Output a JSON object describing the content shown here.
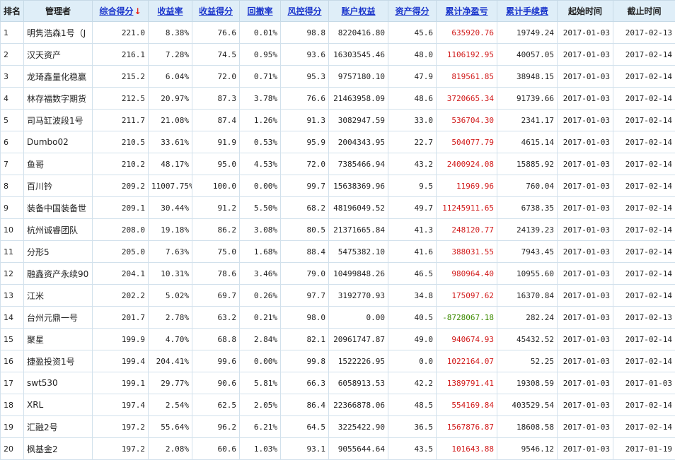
{
  "headers": [
    {
      "key": "rank",
      "label": "排名",
      "sortable": false
    },
    {
      "key": "manager",
      "label": "管理者",
      "sortable": false
    },
    {
      "key": "score",
      "label": "综合得分",
      "sortable": true,
      "active": true,
      "arrow": "↓"
    },
    {
      "key": "return_rate",
      "label": "收益率",
      "sortable": true
    },
    {
      "key": "return_score",
      "label": "收益得分",
      "sortable": true
    },
    {
      "key": "drawdown",
      "label": "回撤率",
      "sortable": true
    },
    {
      "key": "risk_score",
      "label": "风控得分",
      "sortable": true
    },
    {
      "key": "equity",
      "label": "账户权益",
      "sortable": true
    },
    {
      "key": "asset_score",
      "label": "资产得分",
      "sortable": true
    },
    {
      "key": "net_pnl",
      "label": "累计净盈亏",
      "sortable": true
    },
    {
      "key": "fees",
      "label": "累计手续费",
      "sortable": true
    },
    {
      "key": "start",
      "label": "起始时间",
      "sortable": false
    },
    {
      "key": "end",
      "label": "截止时间",
      "sortable": false
    }
  ],
  "rows": [
    {
      "rank": "1",
      "manager": "明隽浩森1号（J",
      "score": "221.0",
      "return_rate": "8.38%",
      "return_score": "76.6",
      "drawdown": "0.01%",
      "risk_score": "98.8",
      "equity": "8220416.80",
      "asset_score": "45.6",
      "net_pnl": "635920.76",
      "net_pnl_sign": "pos",
      "fees": "19749.24",
      "start": "2017-01-03",
      "end": "2017-02-13"
    },
    {
      "rank": "2",
      "manager": "汉天资产",
      "score": "216.1",
      "return_rate": "7.28%",
      "return_score": "74.5",
      "drawdown": "0.95%",
      "risk_score": "93.6",
      "equity": "16303545.46",
      "asset_score": "48.0",
      "net_pnl": "1106192.95",
      "net_pnl_sign": "pos",
      "fees": "40057.05",
      "start": "2017-01-03",
      "end": "2017-02-14"
    },
    {
      "rank": "3",
      "manager": "龙琦鑫量化稳赢",
      "score": "215.2",
      "return_rate": "6.04%",
      "return_score": "72.0",
      "drawdown": "0.71%",
      "risk_score": "95.3",
      "equity": "9757180.10",
      "asset_score": "47.9",
      "net_pnl": "819561.85",
      "net_pnl_sign": "pos",
      "fees": "38948.15",
      "start": "2017-01-03",
      "end": "2017-02-14"
    },
    {
      "rank": "4",
      "manager": "林存福数字期货",
      "score": "212.5",
      "return_rate": "20.97%",
      "return_score": "87.3",
      "drawdown": "3.78%",
      "risk_score": "76.6",
      "equity": "21463958.09",
      "asset_score": "48.6",
      "net_pnl": "3720665.34",
      "net_pnl_sign": "pos",
      "fees": "91739.66",
      "start": "2017-01-03",
      "end": "2017-02-14"
    },
    {
      "rank": "5",
      "manager": "司马缸波段1号",
      "score": "211.7",
      "return_rate": "21.08%",
      "return_score": "87.4",
      "drawdown": "1.26%",
      "risk_score": "91.3",
      "equity": "3082947.59",
      "asset_score": "33.0",
      "net_pnl": "536704.30",
      "net_pnl_sign": "pos",
      "fees": "2341.17",
      "start": "2017-01-03",
      "end": "2017-02-14"
    },
    {
      "rank": "6",
      "manager": "Dumbo02",
      "score": "210.5",
      "return_rate": "33.61%",
      "return_score": "91.9",
      "drawdown": "0.53%",
      "risk_score": "95.9",
      "equity": "2004343.95",
      "asset_score": "22.7",
      "net_pnl": "504077.79",
      "net_pnl_sign": "pos",
      "fees": "4615.14",
      "start": "2017-01-03",
      "end": "2017-02-14"
    },
    {
      "rank": "7",
      "manager": "鱼哥",
      "score": "210.2",
      "return_rate": "48.17%",
      "return_score": "95.0",
      "drawdown": "4.53%",
      "risk_score": "72.0",
      "equity": "7385466.94",
      "asset_score": "43.2",
      "net_pnl": "2400924.08",
      "net_pnl_sign": "pos",
      "fees": "15885.92",
      "start": "2017-01-03",
      "end": "2017-02-14"
    },
    {
      "rank": "8",
      "manager": "百川钤",
      "score": "209.2",
      "return_rate": "11007.75%",
      "return_score": "100.0",
      "drawdown": "0.00%",
      "risk_score": "99.7",
      "equity": "15638369.96",
      "asset_score": "9.5",
      "net_pnl": "11969.96",
      "net_pnl_sign": "pos",
      "fees": "760.04",
      "start": "2017-01-03",
      "end": "2017-02-14"
    },
    {
      "rank": "9",
      "manager": "装备中国装备世",
      "score": "209.1",
      "return_rate": "30.44%",
      "return_score": "91.2",
      "drawdown": "5.50%",
      "risk_score": "68.2",
      "equity": "48196049.52",
      "asset_score": "49.7",
      "net_pnl": "11245911.65",
      "net_pnl_sign": "pos",
      "fees": "6738.35",
      "start": "2017-01-03",
      "end": "2017-02-14"
    },
    {
      "rank": "10",
      "manager": "杭州诚睿团队",
      "score": "208.0",
      "return_rate": "19.18%",
      "return_score": "86.2",
      "drawdown": "3.08%",
      "risk_score": "80.5",
      "equity": "21371665.84",
      "asset_score": "41.3",
      "net_pnl": "248120.77",
      "net_pnl_sign": "pos",
      "fees": "24139.23",
      "start": "2017-01-03",
      "end": "2017-02-14"
    },
    {
      "rank": "11",
      "manager": "分形5",
      "score": "205.0",
      "return_rate": "7.63%",
      "return_score": "75.0",
      "drawdown": "1.68%",
      "risk_score": "88.4",
      "equity": "5475382.10",
      "asset_score": "41.6",
      "net_pnl": "388031.55",
      "net_pnl_sign": "pos",
      "fees": "7943.45",
      "start": "2017-01-03",
      "end": "2017-02-14"
    },
    {
      "rank": "12",
      "manager": "融鑫资产永续90",
      "score": "204.1",
      "return_rate": "10.31%",
      "return_score": "78.6",
      "drawdown": "3.46%",
      "risk_score": "79.0",
      "equity": "10499848.26",
      "asset_score": "46.5",
      "net_pnl": "980964.40",
      "net_pnl_sign": "pos",
      "fees": "10955.60",
      "start": "2017-01-03",
      "end": "2017-02-14"
    },
    {
      "rank": "13",
      "manager": "江米",
      "score": "202.2",
      "return_rate": "5.02%",
      "return_score": "69.7",
      "drawdown": "0.26%",
      "risk_score": "97.7",
      "equity": "3192770.93",
      "asset_score": "34.8",
      "net_pnl": "175097.62",
      "net_pnl_sign": "pos",
      "fees": "16370.84",
      "start": "2017-01-03",
      "end": "2017-02-14"
    },
    {
      "rank": "14",
      "manager": "台州元鼎一号",
      "score": "201.7",
      "return_rate": "2.78%",
      "return_score": "63.2",
      "drawdown": "0.21%",
      "risk_score": "98.0",
      "equity": "0.00",
      "asset_score": "40.5",
      "net_pnl": "-8728067.18",
      "net_pnl_sign": "neg",
      "fees": "282.24",
      "start": "2017-01-03",
      "end": "2017-02-13"
    },
    {
      "rank": "15",
      "manager": "聚星",
      "score": "199.9",
      "return_rate": "4.70%",
      "return_score": "68.8",
      "drawdown": "2.84%",
      "risk_score": "82.1",
      "equity": "20961747.87",
      "asset_score": "49.0",
      "net_pnl": "940674.93",
      "net_pnl_sign": "pos",
      "fees": "45432.52",
      "start": "2017-01-03",
      "end": "2017-02-14"
    },
    {
      "rank": "16",
      "manager": "捷盈投资1号",
      "score": "199.4",
      "return_rate": "204.41%",
      "return_score": "99.6",
      "drawdown": "0.00%",
      "risk_score": "99.8",
      "equity": "1522226.95",
      "asset_score": "0.0",
      "net_pnl": "1022164.07",
      "net_pnl_sign": "pos",
      "fees": "52.25",
      "start": "2017-01-03",
      "end": "2017-02-14"
    },
    {
      "rank": "17",
      "manager": "swt530",
      "score": "199.1",
      "return_rate": "29.77%",
      "return_score": "90.6",
      "drawdown": "5.81%",
      "risk_score": "66.3",
      "equity": "6058913.53",
      "asset_score": "42.2",
      "net_pnl": "1389791.41",
      "net_pnl_sign": "pos",
      "fees": "19308.59",
      "start": "2017-01-03",
      "end": "2017-01-03"
    },
    {
      "rank": "18",
      "manager": "XRL",
      "score": "197.4",
      "return_rate": "2.54%",
      "return_score": "62.5",
      "drawdown": "2.05%",
      "risk_score": "86.4",
      "equity": "22366878.06",
      "asset_score": "48.5",
      "net_pnl": "554169.84",
      "net_pnl_sign": "pos",
      "fees": "403529.54",
      "start": "2017-01-03",
      "end": "2017-02-14"
    },
    {
      "rank": "19",
      "manager": "汇融2号",
      "score": "197.2",
      "return_rate": "55.64%",
      "return_score": "96.2",
      "drawdown": "6.21%",
      "risk_score": "64.5",
      "equity": "3225422.90",
      "asset_score": "36.5",
      "net_pnl": "1567876.87",
      "net_pnl_sign": "pos",
      "fees": "18608.58",
      "start": "2017-01-03",
      "end": "2017-02-14"
    },
    {
      "rank": "20",
      "manager": "枫基金2",
      "score": "197.2",
      "return_rate": "2.08%",
      "return_score": "60.6",
      "drawdown": "1.03%",
      "risk_score": "93.1",
      "equity": "9055644.64",
      "asset_score": "43.5",
      "net_pnl": "101643.88",
      "net_pnl_sign": "pos",
      "fees": "9546.12",
      "start": "2017-01-03",
      "end": "2017-01-19"
    }
  ],
  "colors": {
    "header_bg": "#dfeef8",
    "link": "#1a35cc",
    "arrow": "#e8251b",
    "positive": "#d11a1a",
    "negative": "#3c8a00",
    "grid": "#d2e1ec"
  }
}
